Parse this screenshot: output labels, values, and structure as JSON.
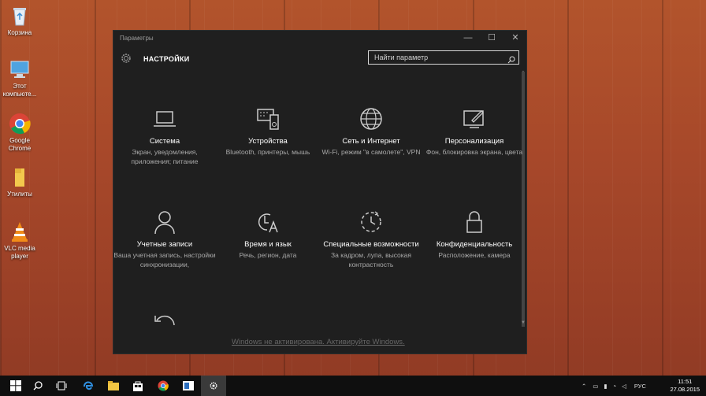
{
  "desktop": {
    "icons": [
      {
        "label": "Корзина",
        "icon": "recycle-bin-icon"
      },
      {
        "label": "Этот компьюте...",
        "icon": "computer-icon"
      },
      {
        "label": "Google Chrome",
        "icon": "chrome-icon"
      },
      {
        "label": "Утилиты",
        "icon": "folder-icon"
      },
      {
        "label": "VLC media player",
        "icon": "vlc-icon"
      }
    ]
  },
  "window": {
    "title": "Параметры",
    "header_title": "НАСТРОЙКИ",
    "search_placeholder": "Найти параметр",
    "tiles": [
      {
        "name": "Система",
        "desc": "Экран, уведомления, приложения; питание",
        "icon": "laptop-icon"
      },
      {
        "name": "Устройства",
        "desc": "Bluetooth, принтеры, мышь",
        "icon": "devices-icon"
      },
      {
        "name": "Сеть и Интернет",
        "desc": "Wi-Fi, режим \"в самолете\", VPN",
        "icon": "globe-icon"
      },
      {
        "name": "Персонализация",
        "desc": "Фон, блокировка экрана, цвета",
        "icon": "personalize-icon"
      },
      {
        "name": "Учетные записи",
        "desc": "Ваша учетная запись, настройки синхронизации,",
        "icon": "person-icon"
      },
      {
        "name": "Время и язык",
        "desc": "Речь, регион, дата",
        "icon": "time-language-icon"
      },
      {
        "name": "Специальные возможности",
        "desc": "За кадром, лупа, высокая контрастность",
        "icon": "accessibility-icon"
      },
      {
        "name": "Конфиденциальность",
        "desc": "Расположение, камера",
        "icon": "lock-icon"
      },
      {
        "name": "",
        "desc": "",
        "icon": "update-icon"
      }
    ],
    "activation_text": "Windows не активирована. Активируйте Windows."
  },
  "taskbar": {
    "language": "РУС",
    "time": "11:51",
    "date": "27.08.2015",
    "items": [
      "start-icon",
      "search-icon",
      "task-view-icon",
      "edge-icon",
      "explorer-icon",
      "store-icon",
      "chrome-icon",
      "app-icon",
      "settings-icon"
    ]
  },
  "colors": {
    "window_bg": "#1f1f1f",
    "accent": "#ffffff",
    "taskbar": "#0f0f0f"
  }
}
